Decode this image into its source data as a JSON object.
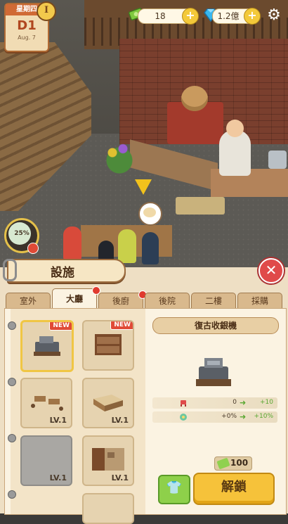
{
  "hud": {
    "weekday": "星期四",
    "day": "D1",
    "date": "Aug. 7",
    "level_badge": "I",
    "cash": "18",
    "gems": "1.2億",
    "plus": "+",
    "progress": "25%"
  },
  "panel": {
    "title": "設施",
    "close": "✕",
    "tabs": [
      {
        "label": "室外",
        "active": false,
        "dot": false
      },
      {
        "label": "大廳",
        "active": true,
        "dot": true
      },
      {
        "label": "後廚",
        "active": false,
        "dot": true
      },
      {
        "label": "後院",
        "active": false,
        "dot": false
      },
      {
        "label": "二樓",
        "active": false,
        "dot": false
      },
      {
        "label": "採購",
        "active": false,
        "dot": false
      }
    ],
    "items": [
      {
        "name": "cash-register",
        "badge": "NEW",
        "level": ""
      },
      {
        "name": "bookshelf",
        "badge": "NEW",
        "level": ""
      },
      {
        "name": "dining-tables",
        "badge": "",
        "level": "LV.1"
      },
      {
        "name": "service-counter",
        "badge": "",
        "level": "LV.1"
      },
      {
        "name": "floor-tile",
        "badge": "",
        "level": "LV.1"
      },
      {
        "name": "wall-panel",
        "badge": "",
        "level": "LV.1"
      }
    ],
    "detail": {
      "title": "復古收銀機",
      "stats": [
        {
          "icon": "seat-icon",
          "current": "0",
          "next": "+10"
        },
        {
          "icon": "decor-icon",
          "current": "+0%",
          "next": "+10%"
        }
      ],
      "cost": "100",
      "unlock_label": "解鎖"
    }
  },
  "colors": {
    "accent": "#f6c23a",
    "panel_bg": "#eedfc4",
    "close_red": "#e04a4a",
    "stat_green": "#5aa832"
  }
}
